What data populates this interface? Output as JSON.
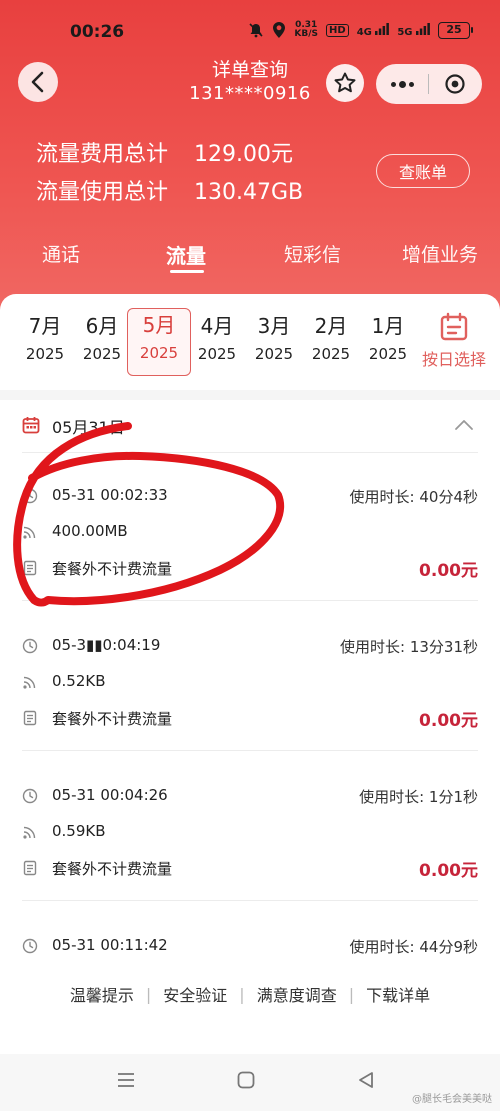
{
  "status_bar": {
    "time": "00:26",
    "speed": "0.31",
    "speed_unit": "KB/S",
    "hd_label": "HD",
    "signal_1": "4G",
    "signal_2": "5G",
    "battery": "25"
  },
  "header": {
    "title": "详单查询",
    "phone": "131****0916",
    "totals": [
      {
        "label": "流量费用总计",
        "value": "129.00元"
      },
      {
        "label": "流量使用总计",
        "value": "130.47GB"
      }
    ],
    "bill_button": "查账单"
  },
  "tabs": [
    {
      "label": "通话",
      "active": false
    },
    {
      "label": "流量",
      "active": true
    },
    {
      "label": "短彩信",
      "active": false
    },
    {
      "label": "增值业务",
      "active": false
    }
  ],
  "months": [
    {
      "month": "7月",
      "year": "2025",
      "active": false
    },
    {
      "month": "6月",
      "year": "2025",
      "active": false
    },
    {
      "month": "5月",
      "year": "2025",
      "active": true
    },
    {
      "month": "4月",
      "year": "2025",
      "active": false
    },
    {
      "month": "3月",
      "year": "2025",
      "active": false
    },
    {
      "month": "2月",
      "year": "2025",
      "active": false
    },
    {
      "month": "1月",
      "year": "2025",
      "active": false
    }
  ],
  "date_picker_label": "按日选择",
  "day_header": "05月31日",
  "records": [
    {
      "time": "05-31 00:02:33",
      "duration_label": "使用时长:",
      "duration": "40分4秒",
      "amount": "400.00MB",
      "type": "套餐外不计费流量",
      "price": "0.00元"
    },
    {
      "time": "05-3▮▮0:04:19",
      "duration_label": "使用时长:",
      "duration": "13分31秒",
      "amount": "0.52KB",
      "type": "套餐外不计费流量",
      "price": "0.00元"
    },
    {
      "time": "05-31 00:04:26",
      "duration_label": "使用时长:",
      "duration": "1分1秒",
      "amount": "0.59KB",
      "type": "套餐外不计费流量",
      "price": "0.00元"
    },
    {
      "time": "05-31 00:11:42",
      "duration_label": "使用时长:",
      "duration": "44分9秒"
    }
  ],
  "footer_links": [
    "温馨提示",
    "安全验证",
    "满意度调查",
    "下载详单"
  ],
  "watermark": "@腿长毛会美美哒",
  "colors": {
    "brand_red": "#e8403f",
    "price_red": "#c6243a",
    "annotation_red": "#e0161b"
  }
}
